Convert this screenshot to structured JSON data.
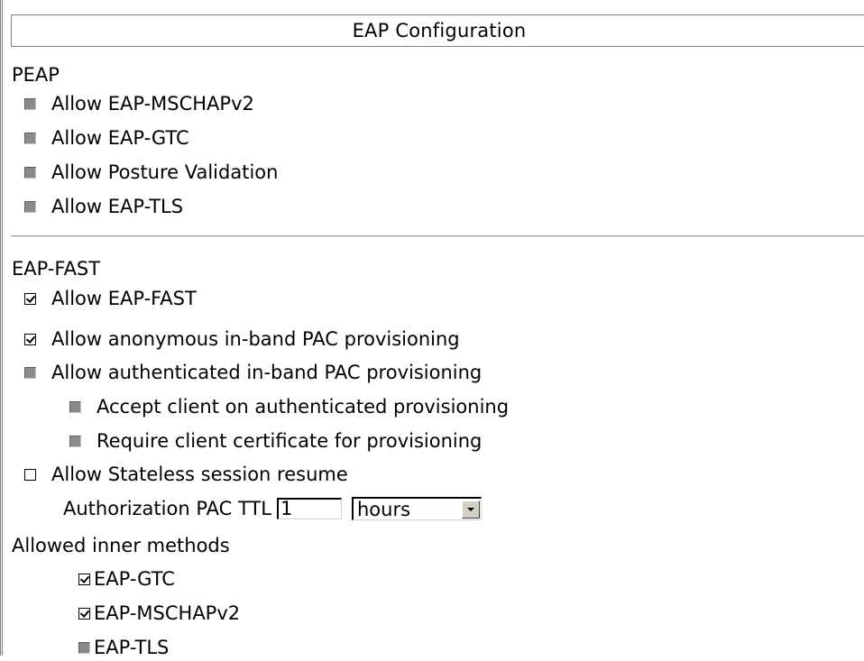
{
  "header": {
    "title": "EAP Configuration"
  },
  "peap": {
    "title": "PEAP",
    "options": [
      {
        "label": "Allow EAP-MSCHAPv2",
        "checked": false,
        "enabled": false
      },
      {
        "label": "Allow EAP-GTC",
        "checked": false,
        "enabled": false
      },
      {
        "label": "Allow Posture Validation",
        "checked": false,
        "enabled": false
      },
      {
        "label": "Allow EAP-TLS",
        "checked": false,
        "enabled": false
      }
    ]
  },
  "eap_fast": {
    "title": "EAP-FAST",
    "allow_eap_fast": {
      "label": "Allow EAP-FAST",
      "checked": true,
      "enabled": true
    },
    "allow_anonymous": {
      "label": "Allow anonymous in-band PAC provisioning",
      "checked": true,
      "enabled": true
    },
    "allow_authenticated": {
      "label": "Allow authenticated in-band PAC provisioning",
      "checked": false,
      "enabled": false
    },
    "accept_client": {
      "label": "Accept client on authenticated provisioning",
      "checked": false,
      "enabled": false
    },
    "require_cert": {
      "label": "Require client certificate for provisioning",
      "checked": false,
      "enabled": false
    },
    "allow_stateless": {
      "label": "Allow Stateless session resume",
      "checked": false,
      "enabled": true
    },
    "pac_ttl": {
      "label": "Authorization PAC TTL",
      "value": "1",
      "unit": "hours"
    },
    "inner_methods": {
      "label": "Allowed inner methods",
      "items": [
        {
          "label": "EAP-GTC",
          "checked": true,
          "enabled": true
        },
        {
          "label": "EAP-MSCHAPv2",
          "checked": true,
          "enabled": true
        },
        {
          "label": "EAP-TLS",
          "checked": false,
          "enabled": false
        }
      ]
    }
  }
}
